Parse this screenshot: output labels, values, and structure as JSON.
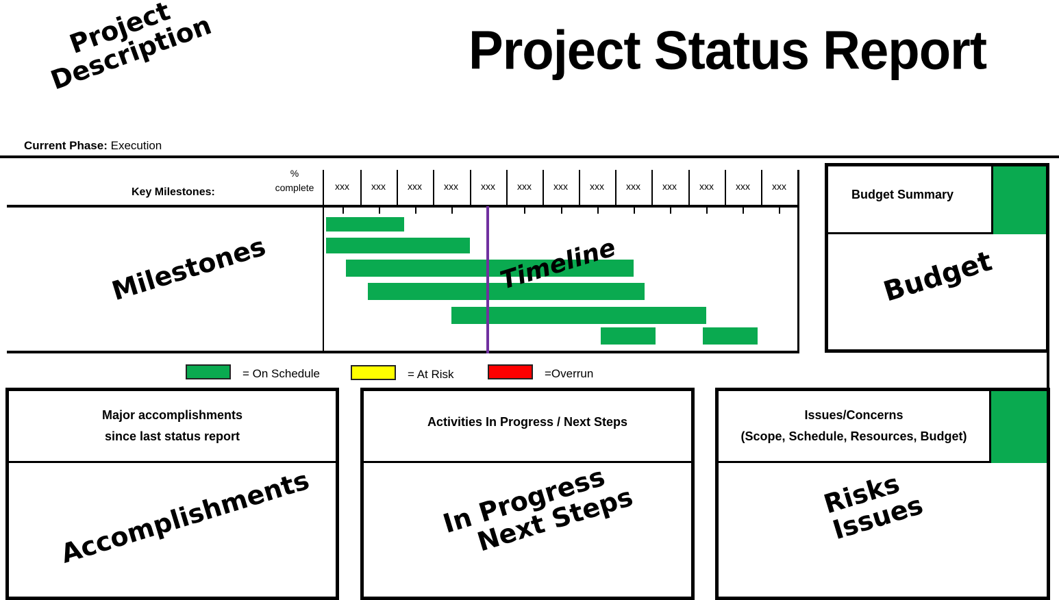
{
  "header": {
    "project_description": [
      "Project",
      "Description"
    ],
    "title": "Project Status Report",
    "current_phase_label": "Current Phase:",
    "current_phase_value": "Execution"
  },
  "milestones": {
    "key_milestones_label": "Key Milestones:",
    "percent_label_1": "%",
    "percent_label_2": "complete",
    "placeholder_label": "Milestones",
    "timeline_label": "Timeline",
    "period_columns": [
      "xxx",
      "xxx",
      "xxx",
      "xxx",
      "xxx",
      "xxx",
      "xxx",
      "xxx",
      "xxx",
      "xxx",
      "xxx",
      "xxx",
      "xxx"
    ]
  },
  "chart_data": {
    "type": "gantt",
    "title": "Timeline",
    "x_categories": [
      "xxx",
      "xxx",
      "xxx",
      "xxx",
      "xxx",
      "xxx",
      "xxx",
      "xxx",
      "xxx",
      "xxx",
      "xxx",
      "xxx",
      "xxx"
    ],
    "x_range": [
      0,
      13
    ],
    "current_date_marker": 4.5,
    "marker_color": "#7030a0",
    "tasks": [
      {
        "row": 0,
        "start": 0.05,
        "end": 2.2,
        "status": "On Schedule"
      },
      {
        "row": 1,
        "start": 0.05,
        "end": 4.0,
        "status": "On Schedule"
      },
      {
        "row": 2,
        "start": 0.6,
        "end": 8.5,
        "status": "On Schedule"
      },
      {
        "row": 3,
        "start": 1.2,
        "end": 8.8,
        "status": "On Schedule"
      },
      {
        "row": 4,
        "start": 3.5,
        "end": 10.5,
        "status": "On Schedule"
      },
      {
        "row": 5,
        "start": 7.6,
        "end": 9.1,
        "status": "On Schedule"
      },
      {
        "row": 5,
        "start": 10.4,
        "end": 11.9,
        "status": "On Schedule"
      }
    ],
    "legend": [
      {
        "label": "= On Schedule",
        "color": "#0aaa50"
      },
      {
        "label": "= At Risk",
        "color": "#ffff00"
      },
      {
        "label": "=Overrun",
        "color": "#ff0000"
      }
    ]
  },
  "budget": {
    "summary_label": "Budget Summary",
    "placeholder_label": "Budget",
    "status_color": "#0aaa50"
  },
  "panels": {
    "accomplishments": {
      "heading_line1": "Major accomplishments",
      "heading_line2": "since last status report",
      "placeholder": "Accomplishments"
    },
    "in_progress": {
      "heading": "Activities In Progress / Next Steps",
      "placeholder_line1": "In Progress",
      "placeholder_line2": "Next Steps"
    },
    "issues": {
      "heading_line1": "Issues/Concerns",
      "heading_line2": "(Scope, Schedule, Resources, Budget)",
      "placeholder_line1": "Risks",
      "placeholder_line2": "Issues",
      "status_color": "#0aaa50"
    }
  }
}
